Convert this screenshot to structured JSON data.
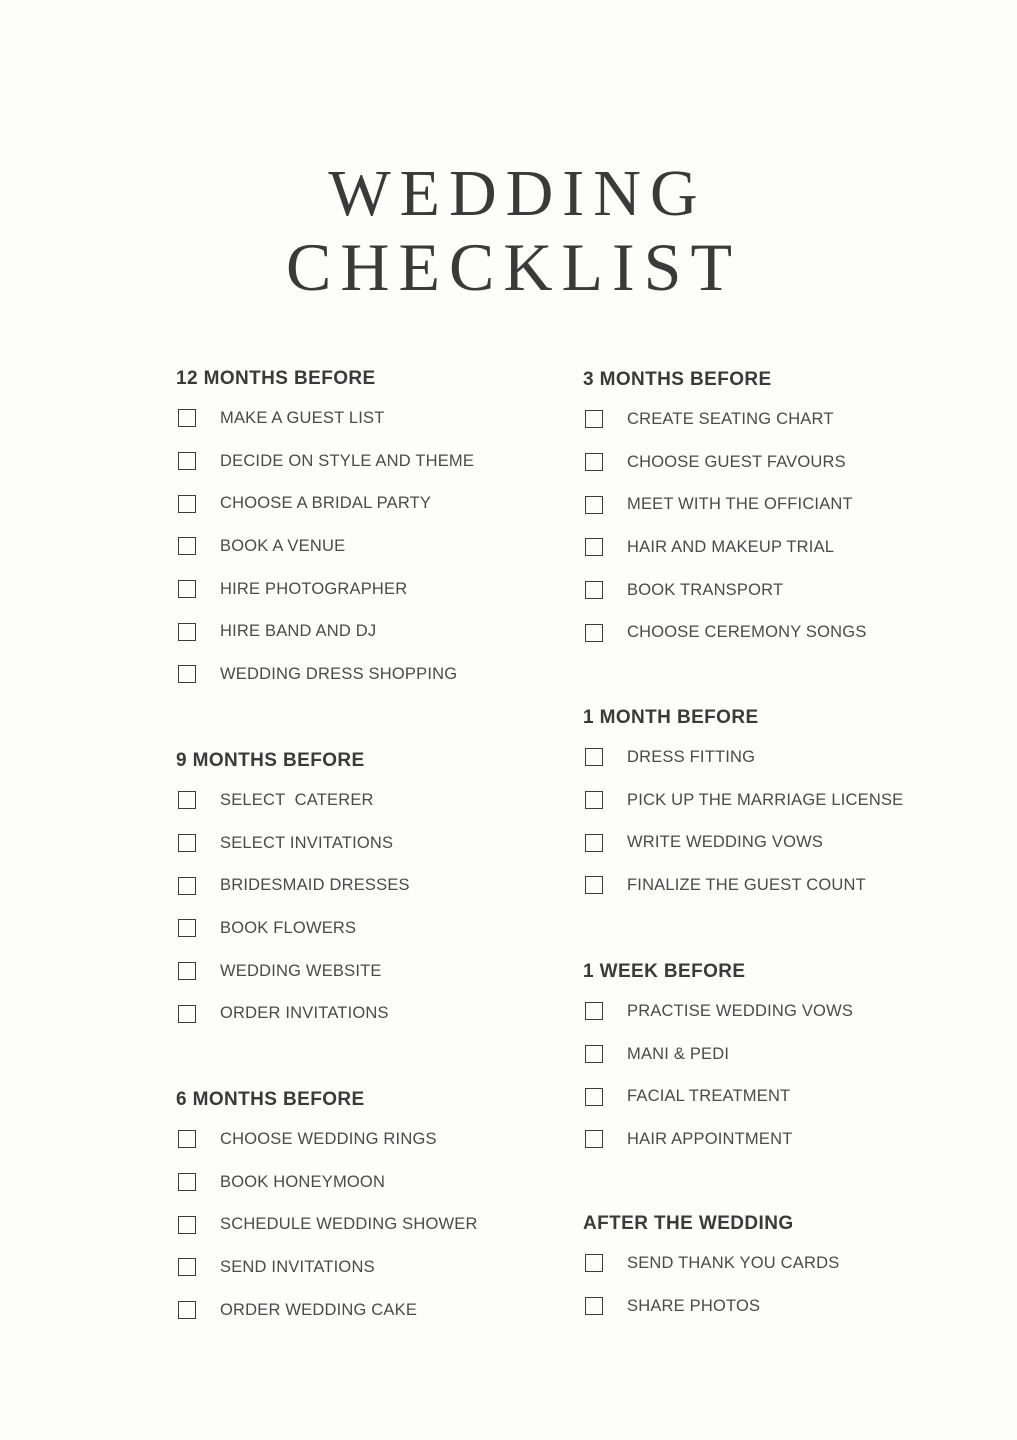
{
  "title": {
    "line1": "WEDDING",
    "line2": "CHECKLIST"
  },
  "sections": [
    {
      "heading": "12 MONTHS BEFORE",
      "items": [
        "MAKE A GUEST LIST",
        "DECIDE ON STYLE AND THEME",
        "CHOOSE A BRIDAL PARTY",
        "BOOK A VENUE",
        "HIRE PHOTOGRAPHER",
        "HIRE BAND AND DJ",
        "WEDDING DRESS SHOPPING"
      ]
    },
    {
      "heading": "9 MONTHS BEFORE",
      "items": [
        "SELECT  CATERER",
        "SELECT INVITATIONS",
        "BRIDESMAID DRESSES",
        "BOOK FLOWERS",
        "WEDDING WEBSITE",
        "ORDER INVITATIONS"
      ]
    },
    {
      "heading": "6 MONTHS BEFORE",
      "items": [
        "CHOOSE WEDDING RINGS",
        "BOOK HONEYMOON",
        "SCHEDULE WEDDING SHOWER",
        "SEND INVITATIONS",
        "ORDER WEDDING CAKE"
      ]
    },
    {
      "heading": "3 MONTHS BEFORE",
      "items": [
        "CREATE SEATING CHART",
        "CHOOSE GUEST FAVOURS",
        "MEET WITH THE OFFICIANT",
        "HAIR AND MAKEUP TRIAL",
        "BOOK TRANSPORT",
        "CHOOSE CEREMONY SONGS"
      ]
    },
    {
      "heading": "1 MONTH BEFORE",
      "items": [
        "DRESS FITTING",
        "PICK UP THE MARRIAGE LICENSE",
        "WRITE WEDDING VOWS",
        "FINALIZE THE GUEST COUNT"
      ]
    },
    {
      "heading": "1 WEEK  BEFORE",
      "items": [
        "PRACTISE WEDDING VOWS",
        "MANI & PEDI",
        "FACIAL TREATMENT",
        "HAIR APPOINTMENT"
      ]
    },
    {
      "heading": "AFTER THE WEDDING",
      "items": [
        "SEND THANK YOU CARDS",
        "SHARE PHOTOS"
      ]
    }
  ]
}
